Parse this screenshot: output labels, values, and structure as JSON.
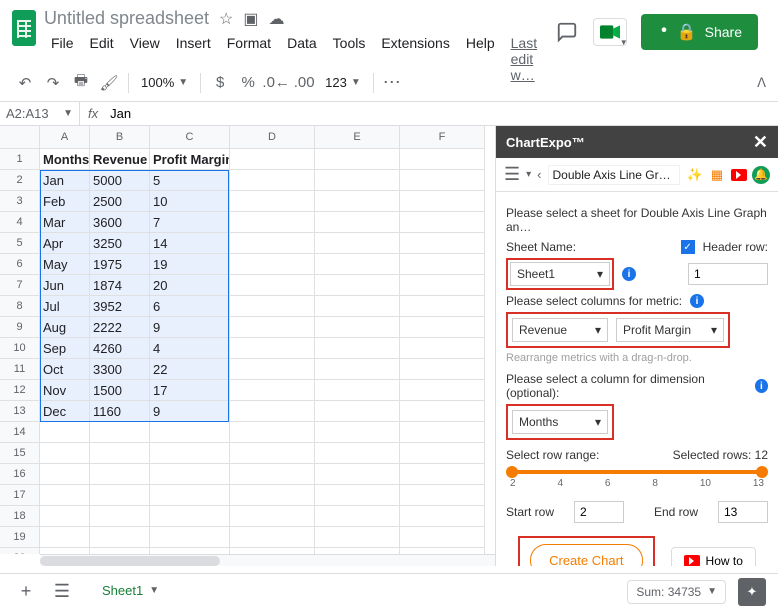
{
  "doc_title": "Untitled spreadsheet",
  "menubar": [
    "File",
    "Edit",
    "View",
    "Insert",
    "Format",
    "Data",
    "Tools",
    "Extensions",
    "Help"
  ],
  "last_edit": "Last edit w…",
  "share_label": "Share",
  "toolbar": {
    "zoom": "100%",
    "fmt": "123"
  },
  "name_box": "A2:A13",
  "formula_value": "Jan",
  "col_headers": [
    "A",
    "B",
    "C",
    "D",
    "E",
    "F"
  ],
  "table": {
    "headers": [
      "Months",
      "Revenue",
      "Profit Margin"
    ],
    "rows": [
      [
        "Jan",
        "5000",
        "5"
      ],
      [
        "Feb",
        "2500",
        "10"
      ],
      [
        "Mar",
        "3600",
        "7"
      ],
      [
        "Apr",
        "3250",
        "14"
      ],
      [
        "May",
        "1975",
        "19"
      ],
      [
        "Jun",
        "1874",
        "20"
      ],
      [
        "Jul",
        "3952",
        "6"
      ],
      [
        "Aug",
        "2222",
        "9"
      ],
      [
        "Sep",
        "4260",
        "4"
      ],
      [
        "Oct",
        "3300",
        "22"
      ],
      [
        "Nov",
        "1500",
        "17"
      ],
      [
        "Dec",
        "1160",
        "9"
      ]
    ]
  },
  "panel": {
    "title": "ChartExpo™",
    "chart_name": "Double Axis Line Gr…",
    "instruction": "Please select a sheet for Double Axis Line Graph an…",
    "sheet_name_label": "Sheet Name:",
    "header_row_label": "Header row:",
    "sheet_selected": "Sheet1",
    "header_row_value": "1",
    "metric_label": "Please select columns for metric:",
    "metric1": "Revenue",
    "metric2": "Profit Margin",
    "rearrange_hint": "Rearrange metrics with a drag-n-drop.",
    "dimension_label": "Please select a column for dimension (optional):",
    "dimension": "Months",
    "range_label": "Select row range:",
    "selected_rows": "Selected rows: 12",
    "ticks": [
      "2",
      "4",
      "6",
      "8",
      "10",
      "13"
    ],
    "start_row_label": "Start row",
    "start_row": "2",
    "end_row_label": "End row",
    "end_row": "13",
    "create_chart": "Create Chart",
    "how_to": "How to"
  },
  "sheet_tab": "Sheet1",
  "sum_label": "Sum: 34735",
  "chart_data": {
    "type": "line",
    "title": "Double Axis Line Graph",
    "categories": [
      "Jan",
      "Feb",
      "Mar",
      "Apr",
      "May",
      "Jun",
      "Jul",
      "Aug",
      "Sep",
      "Oct",
      "Nov",
      "Dec"
    ],
    "series": [
      {
        "name": "Revenue",
        "values": [
          5000,
          2500,
          3600,
          3250,
          1975,
          1874,
          3952,
          2222,
          4260,
          3300,
          1500,
          1160
        ]
      },
      {
        "name": "Profit Margin",
        "values": [
          5,
          10,
          7,
          14,
          19,
          20,
          6,
          9,
          4,
          22,
          17,
          9
        ]
      }
    ],
    "dimension": "Months",
    "row_range": [
      2,
      13
    ]
  }
}
